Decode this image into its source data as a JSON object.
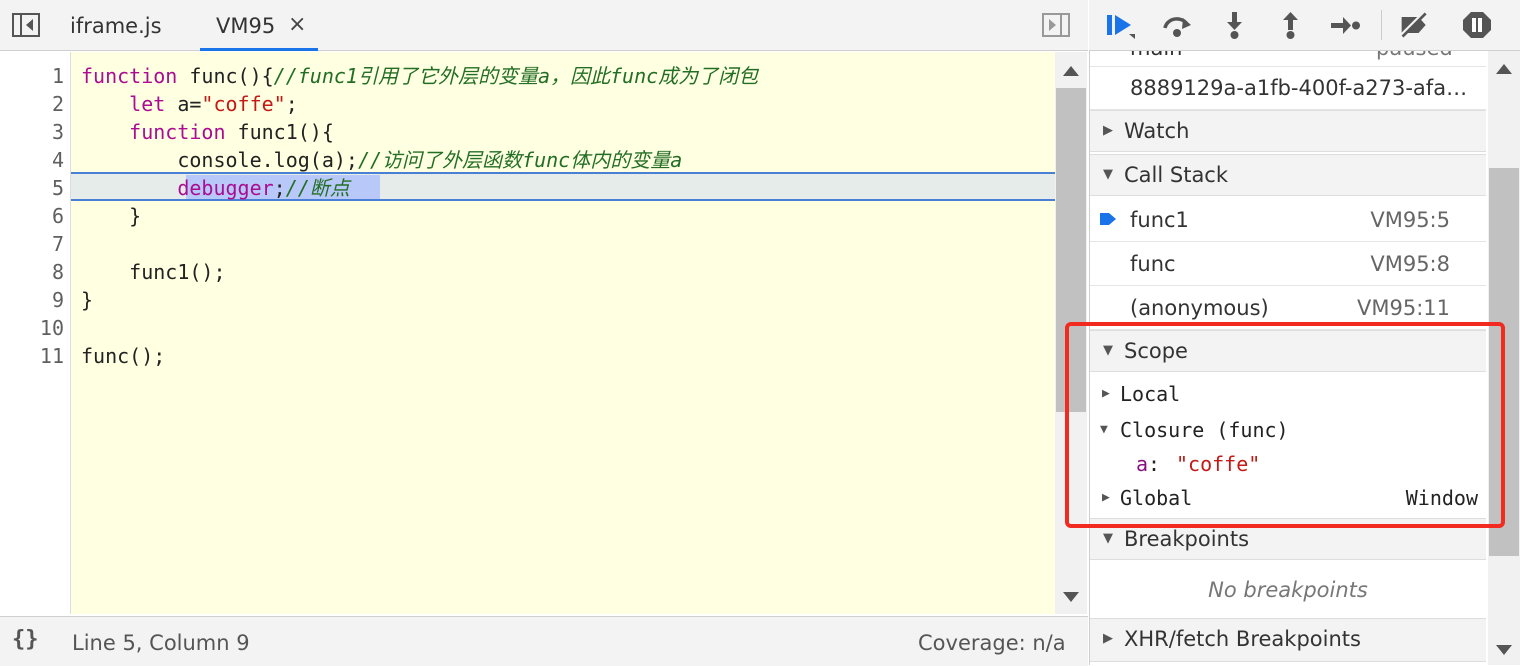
{
  "editor": {
    "tabs": [
      {
        "label": "iframe.js"
      },
      {
        "label": "VM95",
        "close": "×"
      }
    ],
    "code": {
      "line1": {
        "num": "1",
        "kw": "function",
        "name": " func(){",
        "comment": "//func1引用了它外层的变量a，因此func成为了闭包"
      },
      "line2": {
        "num": "2",
        "indent": "    ",
        "kw": "let",
        "mid": " a=",
        "str": "\"coffe\"",
        "end": ";"
      },
      "line3": {
        "num": "3",
        "indent": "    ",
        "kw": "function",
        "name": " func1(){"
      },
      "line4": {
        "num": "4",
        "indent": "        ",
        "code": "console.log(a);",
        "comment": "//访问了外层函数func体内的变量a"
      },
      "line5": {
        "num": "5",
        "indent": "        ",
        "kw": "debugger",
        "end": ";",
        "comment": "//断点"
      },
      "line6": {
        "num": "6",
        "code": "    }"
      },
      "line7": {
        "num": "7",
        "code": ""
      },
      "line8": {
        "num": "8",
        "code": "    func1();"
      },
      "line9": {
        "num": "9",
        "code": "}"
      },
      "line10": {
        "num": "10",
        "code": ""
      },
      "line11": {
        "num": "11",
        "code": "func();"
      }
    },
    "status": {
      "format_icon": "{}",
      "position": "Line 5, Column 9",
      "coverage": "Coverage: n/a"
    }
  },
  "debugger": {
    "threads": {
      "partial_top": "main",
      "partial_state": "paused",
      "thread_id": "8889129a-a1fb-400f-a273-afa…"
    },
    "watch_label": "Watch",
    "call_stack_label": "Call Stack",
    "call_stack": [
      {
        "name": "func1",
        "loc": "VM95:5",
        "current": true
      },
      {
        "name": "func",
        "loc": "VM95:8"
      },
      {
        "name": "(anonymous)",
        "loc": "VM95:11"
      }
    ],
    "scope_label": "Scope",
    "scope": {
      "local": "Local",
      "closure": "Closure (func)",
      "var_name": "a",
      "var_sep": ": ",
      "var_value": "\"coffe\"",
      "global": "Global",
      "global_value": "Window"
    },
    "breakpoints_label": "Breakpoints",
    "no_breakpoints": "No breakpoints",
    "xhr_label": "XHR/fetch Breakpoints"
  },
  "colors": {
    "accent": "#1a73e8",
    "highlight_box": "#f22a1f",
    "editor_bg": "#ffffe1"
  }
}
